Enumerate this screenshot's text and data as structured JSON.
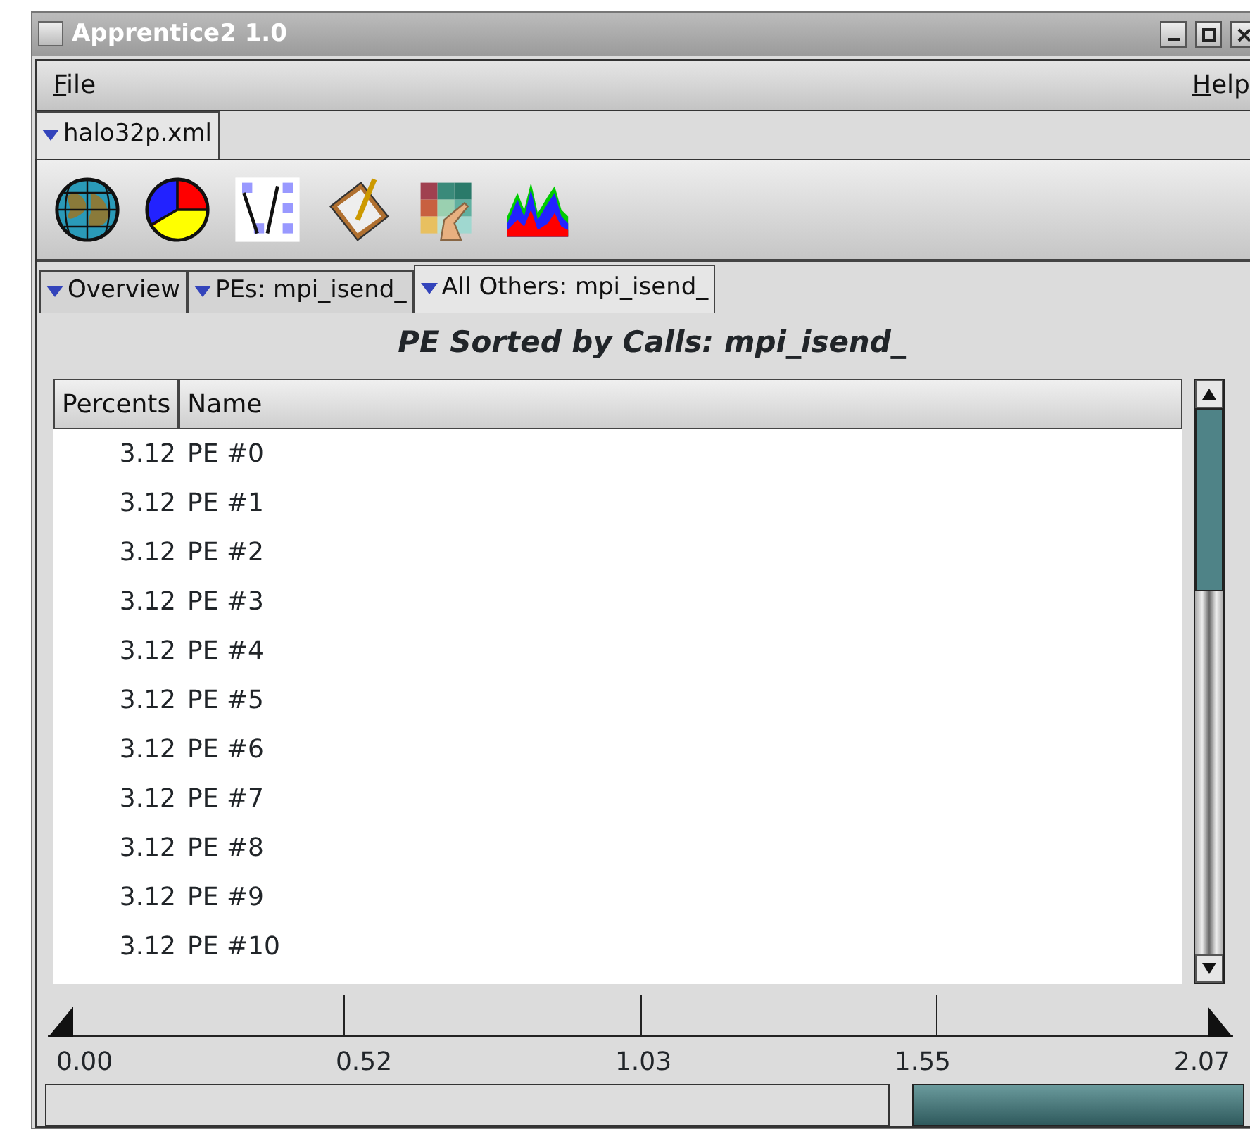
{
  "window": {
    "title": "Apprentice2 1.0"
  },
  "menu": [
    {
      "mnemonic": "F",
      "rest": "ile"
    },
    {
      "mnemonic": "H",
      "rest": "elp"
    }
  ],
  "file_tabs": [
    {
      "label": "halo32p.xml",
      "selected": true
    }
  ],
  "toolbar": [
    {
      "kind": "globe"
    },
    {
      "kind": "pie"
    },
    {
      "kind": "trace"
    },
    {
      "kind": "clipboard"
    },
    {
      "kind": "grid"
    },
    {
      "kind": "histogram"
    }
  ],
  "view_tabs": [
    {
      "label": "Overview",
      "selected": false
    },
    {
      "label": "PEs: mpi_isend_",
      "selected": false
    },
    {
      "label": "All Others: mpi_isend_",
      "selected": true
    }
  ],
  "report": {
    "title": "PE Sorted by Calls: mpi_isend_",
    "columns": [
      "Percents",
      "Name"
    ],
    "rows": [
      {
        "percent": "3.12",
        "name": "PE #0"
      },
      {
        "percent": "3.12",
        "name": "PE #1"
      },
      {
        "percent": "3.12",
        "name": "PE #2"
      },
      {
        "percent": "3.12",
        "name": "PE #3"
      },
      {
        "percent": "3.12",
        "name": "PE #4"
      },
      {
        "percent": "3.12",
        "name": "PE #5"
      },
      {
        "percent": "3.12",
        "name": "PE #6"
      },
      {
        "percent": "3.12",
        "name": "PE #7"
      },
      {
        "percent": "3.12",
        "name": "PE #8"
      },
      {
        "percent": "3.12",
        "name": "PE #9"
      },
      {
        "percent": "3.12",
        "name": "PE #10"
      }
    ]
  },
  "range_slider": {
    "thumbs": [
      {
        "level": 0
      },
      {
        "level": 1
      }
    ],
    "ticks": [
      "0.00",
      "0.52",
      "1.03",
      "1.55",
      "2.07"
    ]
  }
}
